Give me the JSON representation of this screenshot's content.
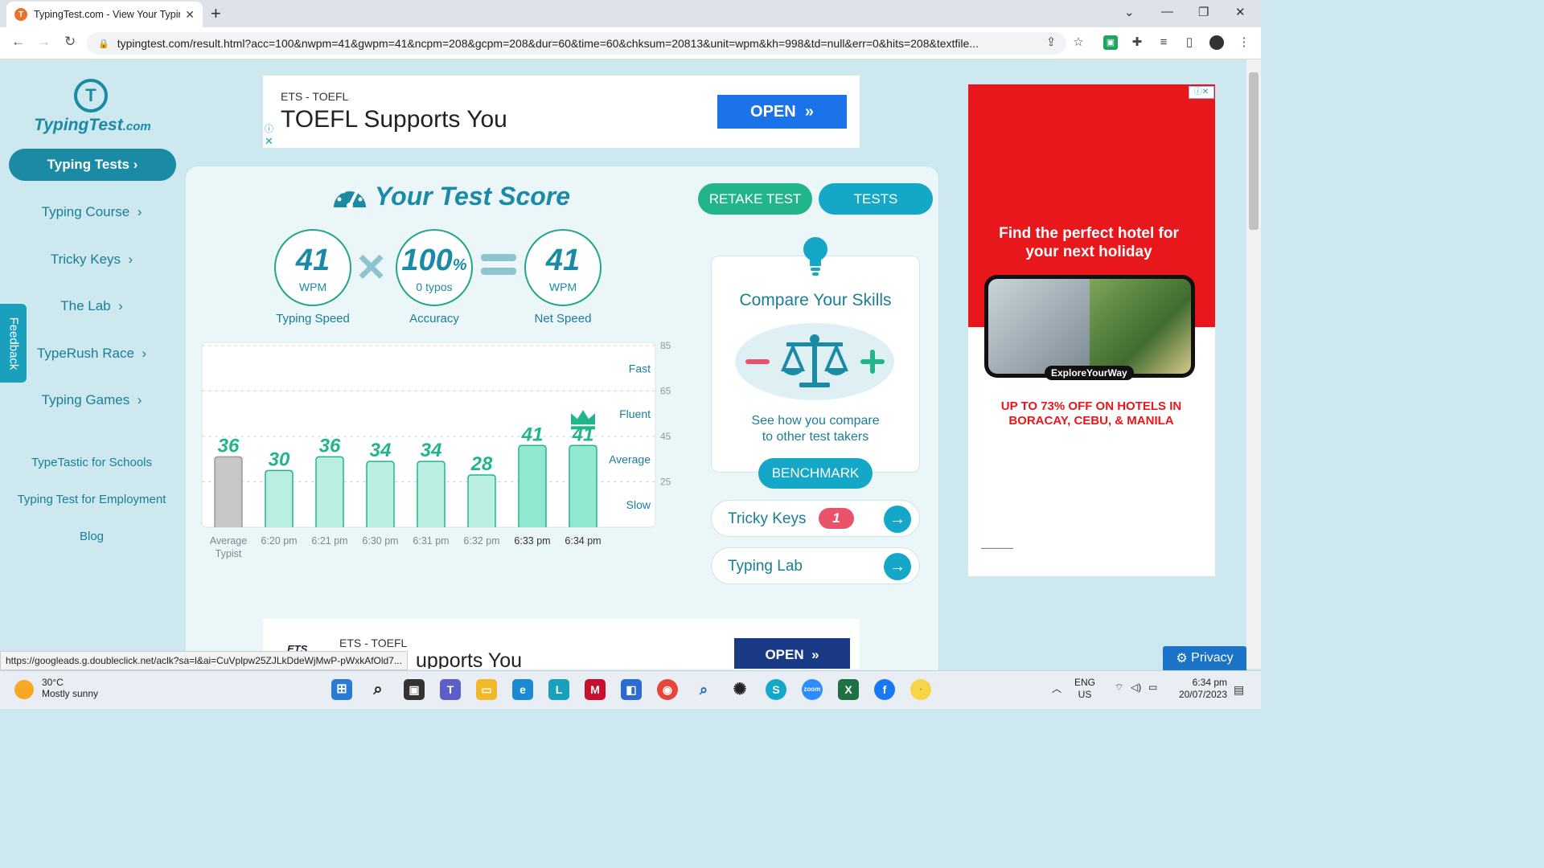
{
  "browser": {
    "tab_title": "TypingTest.com - View Your Typin",
    "url": "typingtest.com/result.html?acc=100&nwpm=41&gwpm=41&ncpm=208&gcpm=208&dur=60&time=60&chksum=20813&unit=wpm&kh=998&td=null&err=0&hits=208&textfile...",
    "status_url": "https://googleads.g.doubleclick.net/aclk?sa=l&ai=CuVplpw25ZJLkDdeWjMwP-pWxkAfOld7..."
  },
  "sidebar": {
    "brand": "TypingTest",
    "brand_suffix": ".com",
    "items": [
      {
        "label": "Typing Tests"
      },
      {
        "label": "Typing Course"
      },
      {
        "label": "Tricky Keys"
      },
      {
        "label": "The Lab"
      },
      {
        "label": "TypeRush Race"
      },
      {
        "label": "Typing Games"
      }
    ],
    "links": [
      "TypeTastic for Schools",
      "Typing Test for Employment",
      "Blog"
    ],
    "feedback": "Feedback"
  },
  "ads": {
    "top": {
      "sponsor": "ETS - TOEFL",
      "headline": "TOEFL Supports You",
      "button": "OPEN"
    },
    "bottom": {
      "sponsor": "ETS - TOEFL",
      "headline": "upports You",
      "button": "OPEN",
      "logo": "ETS"
    },
    "right": {
      "headline": "Find the perfect hotel for your next holiday",
      "tag": "ExploreYourWay",
      "offer": "UP TO 73% OFF ON HOTELS IN BORACAY, CEBU, & MANILA"
    },
    "privacy": "Privacy"
  },
  "score": {
    "title": "Your Test Score",
    "retake": "RETAKE TEST",
    "tests": "TESTS",
    "typing_speed": {
      "value": "41",
      "unit": "WPM",
      "label": "Typing Speed"
    },
    "accuracy": {
      "value": "100",
      "unit": "%",
      "sub": "0  typos",
      "label": "Accuracy"
    },
    "net_speed": {
      "value": "41",
      "unit": "WPM",
      "label": "Net Speed"
    }
  },
  "chart_data": {
    "type": "bar",
    "categories": [
      "Average Typist",
      "6:20 pm",
      "6:21 pm",
      "6:30 pm",
      "6:31 pm",
      "6:32 pm",
      "6:33 pm",
      "6:34 pm"
    ],
    "values": [
      36,
      30,
      36,
      34,
      34,
      28,
      41,
      41
    ],
    "ylim": [
      5,
      85
    ],
    "yticks": [
      85,
      65,
      45,
      25
    ],
    "bands": [
      "Fast",
      "Fluent",
      "Average",
      "Slow"
    ],
    "highlight_latest": true,
    "colors": {
      "average": "#c7c7c7",
      "normal": "#b9eee0",
      "recent": "#8fe8cf",
      "label": "#22b58c"
    }
  },
  "compare": {
    "title": "Compare Your Skills",
    "desc_line1": "See how you compare",
    "desc_line2": "to other test takers",
    "button": "BENCHMARK"
  },
  "links": [
    {
      "label": "Tricky Keys",
      "badge": "1"
    },
    {
      "label": "Typing Lab"
    }
  ],
  "taskbar": {
    "temp": "30°C",
    "weather": "Mostly sunny",
    "lang": "ENG",
    "region": "US",
    "time": "6:34 pm",
    "date": "20/07/2023"
  }
}
